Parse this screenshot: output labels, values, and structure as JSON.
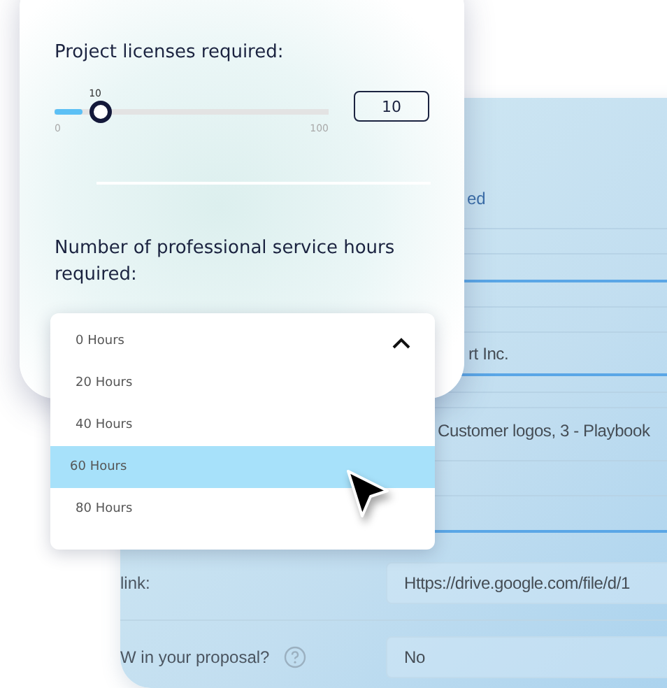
{
  "back_form": {
    "heading_fragment": "ed",
    "rows": [
      {
        "kind": "value",
        "value": "rt Inc."
      },
      {
        "kind": "value",
        "value": "Customer logos, 3 - Playbook"
      },
      {
        "kind": "field",
        "label": "link:",
        "value": "Https://drive.google.com/file/d/1",
        "help": false
      },
      {
        "kind": "field",
        "label": "W in your proposal?",
        "value": "No",
        "help": true
      }
    ]
  },
  "licenses": {
    "label": "Project licenses required:",
    "thumb_label": "10",
    "min_label": "0",
    "max_label": "100",
    "level": 0.1,
    "value": "10"
  },
  "hours": {
    "label": "Number of professional service hours required:",
    "expanded": true,
    "options": [
      {
        "label": "0 Hours",
        "selected": false
      },
      {
        "label": "20 Hours",
        "selected": false
      },
      {
        "label": "40 Hours",
        "selected": false
      },
      {
        "label": "60 Hours",
        "selected": true
      },
      {
        "label": "80 Hours",
        "selected": false
      }
    ]
  }
}
